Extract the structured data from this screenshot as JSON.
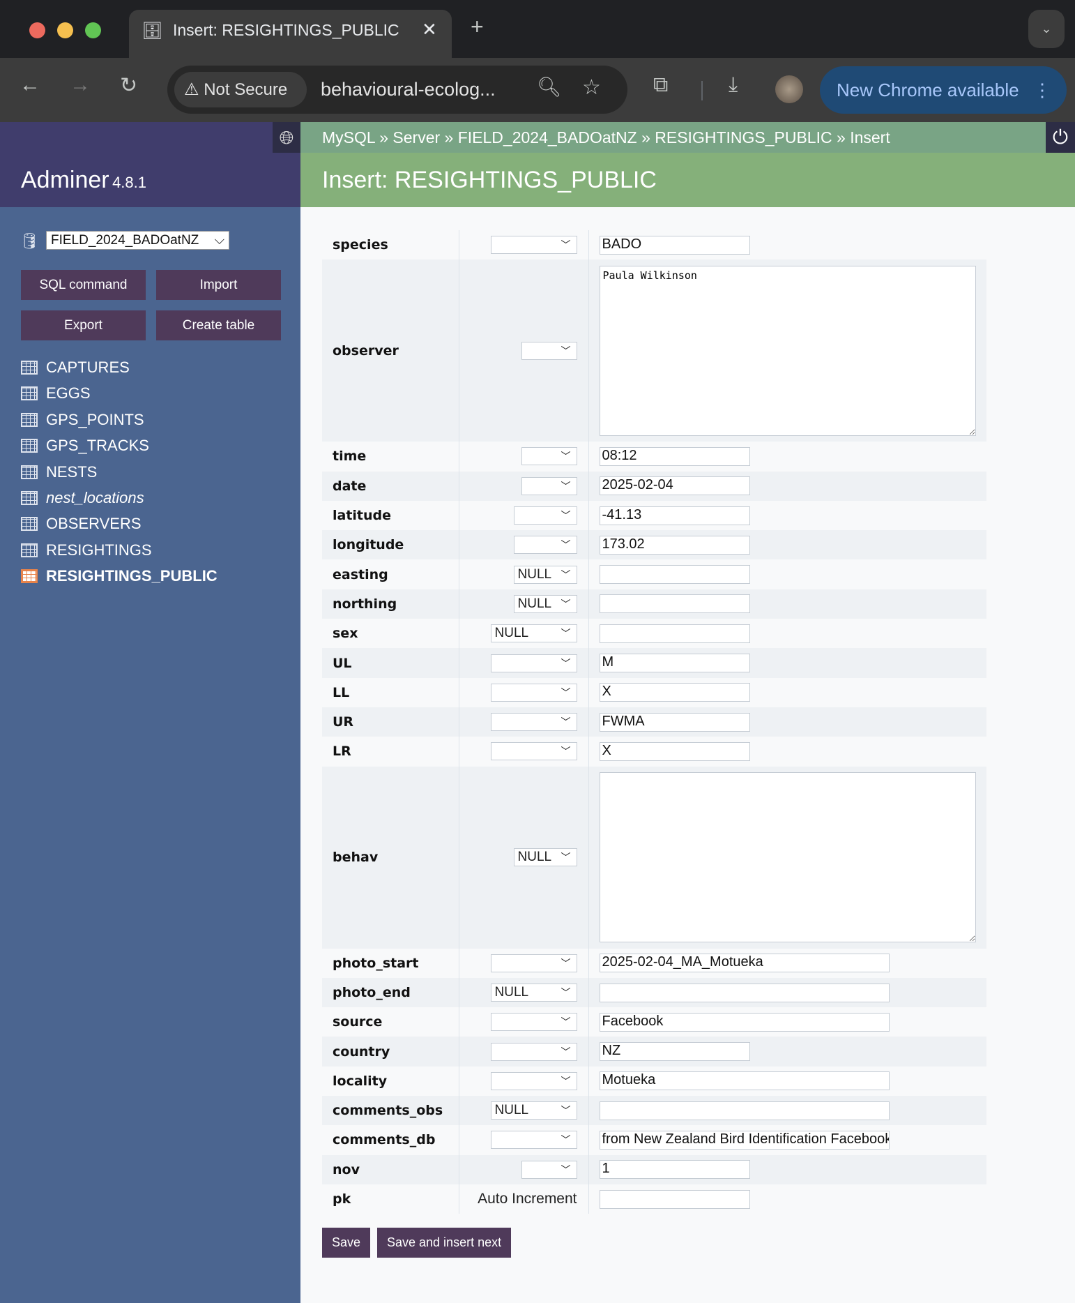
{
  "browser": {
    "tab_title": "Insert: RESIGHTINGS_PUBLIC",
    "security": "Not Secure",
    "url": "behavioural-ecolog...",
    "update_label": "New Chrome available"
  },
  "sidebar": {
    "app_name": "Adminer",
    "version": "4.8.1",
    "database": "FIELD_2024_BADOatNZ",
    "buttons": [
      "SQL command",
      "Import",
      "Export",
      "Create table"
    ],
    "tables": [
      {
        "label": "CAPTURES"
      },
      {
        "label": "EGGS"
      },
      {
        "label": "GPS_POINTS"
      },
      {
        "label": "GPS_TRACKS"
      },
      {
        "label": "NESTS"
      },
      {
        "label": "nest_locations",
        "view": true
      },
      {
        "label": "OBSERVERS"
      },
      {
        "label": "RESIGHTINGS"
      },
      {
        "label": "RESIGHTINGS_PUBLIC",
        "active": true
      }
    ]
  },
  "breadcrumb": [
    "MySQL",
    "Server",
    "FIELD_2024_BADOatNZ",
    "RESIGHTINGS_PUBLIC",
    "Insert"
  ],
  "page_title": "Insert: RESIGHTINGS_PUBLIC",
  "fields": [
    {
      "name": "species",
      "function": "",
      "sel": "w",
      "value": "BADO",
      "type": "short"
    },
    {
      "name": "observer",
      "function": "",
      "sel": "s",
      "value": "Paula Wilkinson",
      "type": "textarea"
    },
    {
      "name": "time",
      "function": "",
      "sel": "s",
      "value": "08:12",
      "type": "short"
    },
    {
      "name": "date",
      "function": "",
      "sel": "s",
      "value": "2025-02-04",
      "type": "short"
    },
    {
      "name": "latitude",
      "function": "",
      "sel": "m",
      "value": "-41.13",
      "type": "short"
    },
    {
      "name": "longitude",
      "function": "",
      "sel": "m",
      "value": "173.02",
      "type": "short"
    },
    {
      "name": "easting",
      "function": "NULL",
      "sel": "m",
      "value": "",
      "type": "short"
    },
    {
      "name": "northing",
      "function": "NULL",
      "sel": "m",
      "value": "",
      "type": "short"
    },
    {
      "name": "sex",
      "function": "NULL",
      "sel": "w",
      "value": "",
      "type": "short"
    },
    {
      "name": "UL",
      "function": "",
      "sel": "w",
      "value": "M",
      "type": "short"
    },
    {
      "name": "LL",
      "function": "",
      "sel": "w",
      "value": "X",
      "type": "short"
    },
    {
      "name": "UR",
      "function": "",
      "sel": "w",
      "value": "FWMA",
      "type": "short"
    },
    {
      "name": "LR",
      "function": "",
      "sel": "w",
      "value": "X",
      "type": "short"
    },
    {
      "name": "behav",
      "function": "NULL",
      "sel": "m",
      "value": "",
      "type": "textarea"
    },
    {
      "name": "photo_start",
      "function": "",
      "sel": "w",
      "value": "2025-02-04_MA_Motueka",
      "type": "long"
    },
    {
      "name": "photo_end",
      "function": "NULL",
      "sel": "w",
      "value": "",
      "type": "long"
    },
    {
      "name": "source",
      "function": "",
      "sel": "w",
      "value": "Facebook",
      "type": "long"
    },
    {
      "name": "country",
      "function": "",
      "sel": "w",
      "value": "NZ",
      "type": "short"
    },
    {
      "name": "locality",
      "function": "",
      "sel": "w",
      "value": "Motueka",
      "type": "long"
    },
    {
      "name": "comments_obs",
      "function": "NULL",
      "sel": "w",
      "value": "",
      "type": "long"
    },
    {
      "name": "comments_db",
      "function": "",
      "sel": "w",
      "value": "from New Zealand Bird Identification Facebook",
      "type": "long"
    },
    {
      "name": "nov",
      "function": "",
      "sel": "s",
      "value": "1",
      "type": "short"
    },
    {
      "name": "pk",
      "function_text": "Auto Increment",
      "value": "",
      "type": "short"
    }
  ],
  "actions": {
    "save": "Save",
    "save_next": "Save and insert next"
  }
}
